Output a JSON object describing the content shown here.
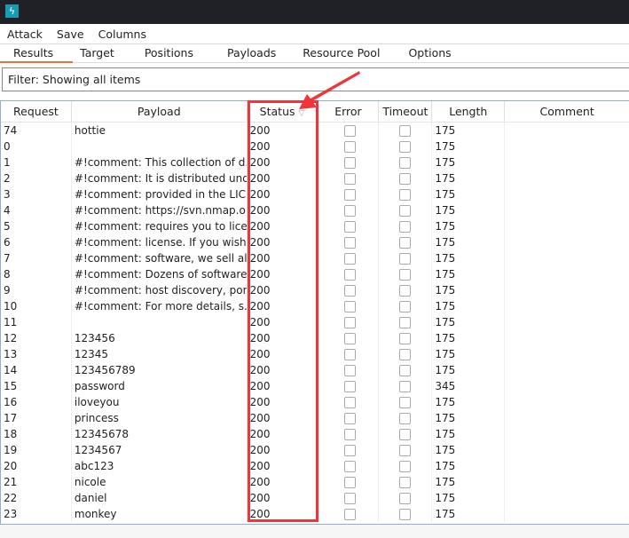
{
  "menu": [
    "Attack",
    "Save",
    "Columns"
  ],
  "tabs": [
    {
      "label": "Results",
      "active": true
    },
    {
      "label": "Target"
    },
    {
      "label": "Positions"
    },
    {
      "label": "Payloads"
    },
    {
      "label": "Resource Pool"
    },
    {
      "label": "Options"
    }
  ],
  "filter": "Filter: Showing all items",
  "columns": [
    "Request",
    "Payload",
    "Status",
    "Error",
    "Timeout",
    "Length",
    "Comment"
  ],
  "sort_icon": "chevron-down-icon",
  "accent": "#f26d32",
  "highlight_color": "#f0353a",
  "rows": [
    [
      "74",
      "hottie",
      "200",
      "175"
    ],
    [
      "0",
      "",
      "200",
      "175"
    ],
    [
      "1",
      "#!comment: This collection of d...",
      "200",
      "175"
    ],
    [
      "2",
      "#!comment: It is distributed und...",
      "200",
      "175"
    ],
    [
      "3",
      "#!comment: provided in the LIC...",
      "200",
      "175"
    ],
    [
      "4",
      "#!comment: https://svn.nmap.or...",
      "200",
      "175"
    ],
    [
      "5",
      "#!comment: requires you to lice...",
      "200",
      "175"
    ],
    [
      "6",
      "#!comment: license.  If you wish ...",
      "200",
      "175"
    ],
    [
      "7",
      "#!comment: software, we sell al...",
      "200",
      "175"
    ],
    [
      "8",
      "#!comment: Dozens of software...",
      "200",
      "175"
    ],
    [
      "9",
      "#!comment: host discovery, port...",
      "200",
      "175"
    ],
    [
      "10",
      "#!comment: For more details, s...",
      "200",
      "175"
    ],
    [
      "11",
      "",
      "200",
      "175"
    ],
    [
      "12",
      "123456",
      "200",
      "175"
    ],
    [
      "13",
      "12345",
      "200",
      "175"
    ],
    [
      "14",
      "123456789",
      "200",
      "175"
    ],
    [
      "15",
      "password",
      "200",
      "345"
    ],
    [
      "16",
      "iloveyou",
      "200",
      "175"
    ],
    [
      "17",
      "princess",
      "200",
      "175"
    ],
    [
      "18",
      "12345678",
      "200",
      "175"
    ],
    [
      "19",
      "1234567",
      "200",
      "175"
    ],
    [
      "20",
      "abc123",
      "200",
      "175"
    ],
    [
      "21",
      "nicole",
      "200",
      "175"
    ],
    [
      "22",
      "daniel",
      "200",
      "175"
    ],
    [
      "23",
      "monkey",
      "200",
      "175"
    ]
  ]
}
